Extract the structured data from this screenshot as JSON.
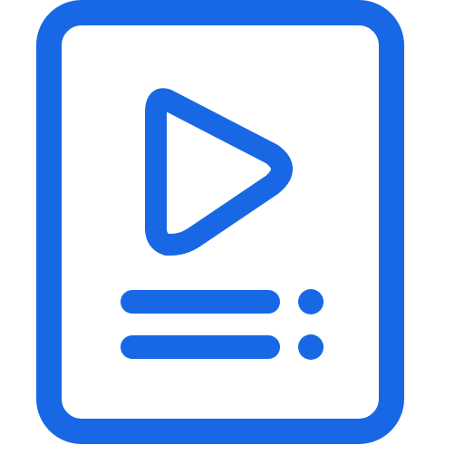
{
  "icon": {
    "name": "video-playlist-document-icon",
    "color": "#1868E6",
    "background": "#FFFFFF",
    "parts": {
      "document": "document-frame",
      "play": "play-triangle",
      "list": [
        "list-line-1",
        "list-line-2"
      ],
      "dots": [
        "list-dot-1",
        "list-dot-2"
      ]
    }
  }
}
